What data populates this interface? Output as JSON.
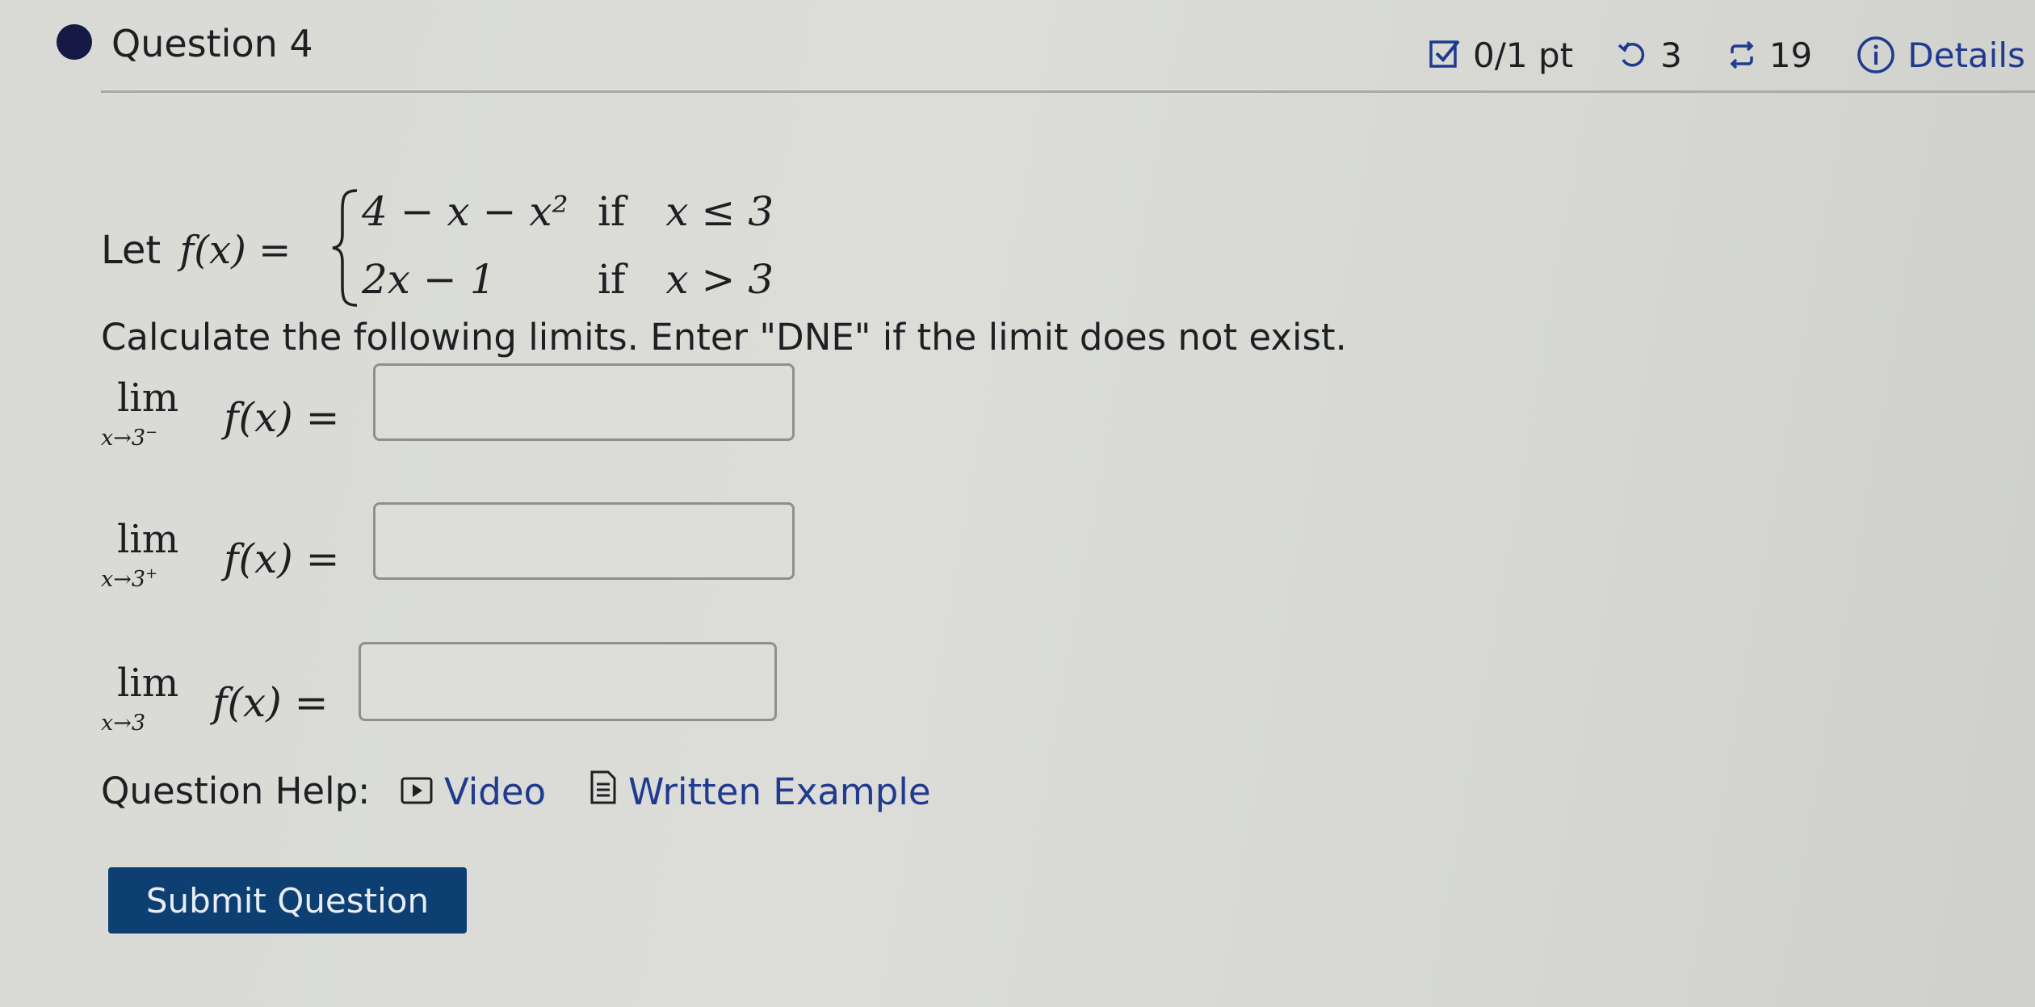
{
  "question": {
    "title": "Question 4",
    "score": "0/1 pt",
    "retries": "3",
    "attempts": "19",
    "details_label": "Details"
  },
  "problem": {
    "let_text": "Let",
    "func_lhs": "f(x) =",
    "piece1_expr": "4 − x − x²",
    "piece1_if": "if",
    "piece1_cond": "x ≤ 3",
    "piece2_expr": "2x − 1",
    "piece2_if": "if",
    "piece2_cond": "x > 3",
    "instructions": "Calculate the following limits. Enter \"DNE\" if the limit does not exist."
  },
  "limits": [
    {
      "lim": "lim",
      "sub": "x→3",
      "sup": "−",
      "expr": "f(x) =",
      "value": ""
    },
    {
      "lim": "lim",
      "sub": "x→3",
      "sup": "+",
      "expr": "f(x) =",
      "value": ""
    },
    {
      "lim": "lim",
      "sub": "x→3",
      "sup": "",
      "expr": "f(x) =",
      "value": ""
    }
  ],
  "help": {
    "label": "Question Help:",
    "video_label": "Video",
    "example_label": "Written Example"
  },
  "submit_label": "Submit Question",
  "colors": {
    "primary_button": "#0d3f73",
    "link": "#1f3a8f",
    "status_dot": "#141a44"
  },
  "icons": [
    "checkbox-icon",
    "retry-icon",
    "attempts-icon",
    "info-icon",
    "video-icon",
    "document-icon"
  ]
}
